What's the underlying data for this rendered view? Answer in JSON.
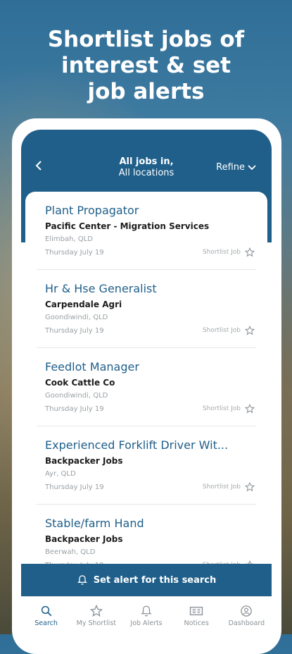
{
  "promo": {
    "headline_lines": [
      "Shortlist jobs of",
      "interest & set",
      "job alerts"
    ]
  },
  "header": {
    "title": "All jobs in,",
    "subtitle": "All locations",
    "refine_label": "Refine"
  },
  "jobs": [
    {
      "title": "Plant Propagator",
      "company": "Pacific Center - Migration Services",
      "location": "Elimbah, QLD",
      "date": "Thursday July 19",
      "shortlist": "Shortlist Job"
    },
    {
      "title": "Hr & Hse Generalist",
      "company": "Carpendale Agri",
      "location": "Goondiwindi, QLD",
      "date": "Thursday July 19",
      "shortlist": "Shortlist Job"
    },
    {
      "title": "Feedlot Manager",
      "company": "Cook Cattle Co",
      "location": "Goondiwindi, QLD",
      "date": "Thursday July 19",
      "shortlist": "Shortlist Job"
    },
    {
      "title": "Experienced Forklift Driver Wit...",
      "company": "Backpacker Jobs",
      "location": "Ayr, QLD",
      "date": "Thursday July 19",
      "shortlist": "Shortlist Job"
    },
    {
      "title": "Stable/farm Hand",
      "company": "Backpacker Jobs",
      "location": "Beerwah, QLD",
      "date": "Thursday July 19",
      "shortlist": "Shortlist Job"
    }
  ],
  "alert_button": "Set alert for this search",
  "tabs": [
    {
      "label": "Search",
      "icon": "search-icon"
    },
    {
      "label": "My Shortlist",
      "icon": "star-icon"
    },
    {
      "label": "Job Alerts",
      "icon": "bell-icon"
    },
    {
      "label": "Notices",
      "icon": "notices-icon"
    },
    {
      "label": "Dashboard",
      "icon": "user-icon"
    }
  ],
  "colors": {
    "primary": "#1f5f8a",
    "muted": "#9aa0a5"
  }
}
